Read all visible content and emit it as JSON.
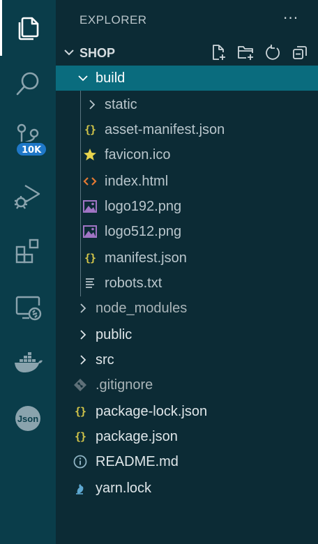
{
  "activity_bar": {
    "items": [
      {
        "name": "explorer",
        "icon": "files-icon",
        "active": true
      },
      {
        "name": "search",
        "icon": "search-icon"
      },
      {
        "name": "source-control",
        "icon": "source-control-icon",
        "badge": "10K"
      },
      {
        "name": "run-debug",
        "icon": "run-debug-icon"
      },
      {
        "name": "extensions",
        "icon": "extensions-icon"
      },
      {
        "name": "remote-explorer",
        "icon": "remote-explorer-icon"
      },
      {
        "name": "docker",
        "icon": "docker-icon"
      },
      {
        "name": "json",
        "icon": "json-icon",
        "text": "Json"
      }
    ]
  },
  "sidebar": {
    "header": "EXPLORER",
    "more": "···",
    "section": {
      "title": "SHOP",
      "actions": [
        "new-file-icon",
        "new-folder-icon",
        "refresh-icon",
        "collapse-all-icon"
      ]
    },
    "tree": [
      {
        "label": "build",
        "type": "folder",
        "expanded": true,
        "selected": true
      },
      {
        "label": "static",
        "type": "folder"
      },
      {
        "label": "asset-manifest.json",
        "type": "json"
      },
      {
        "label": "favicon.ico",
        "type": "favicon"
      },
      {
        "label": "index.html",
        "type": "html"
      },
      {
        "label": "logo192.png",
        "type": "image"
      },
      {
        "label": "logo512.png",
        "type": "image"
      },
      {
        "label": "manifest.json",
        "type": "json"
      },
      {
        "label": "robots.txt",
        "type": "text"
      },
      {
        "label": "node_modules",
        "type": "folder"
      },
      {
        "label": "public",
        "type": "folder"
      },
      {
        "label": "src",
        "type": "folder"
      },
      {
        "label": ".gitignore",
        "type": "git"
      },
      {
        "label": "package-lock.json",
        "type": "json"
      },
      {
        "label": "package.json",
        "type": "json"
      },
      {
        "label": "README.md",
        "type": "info"
      },
      {
        "label": "yarn.lock",
        "type": "yarn"
      }
    ]
  },
  "colors": {
    "activity_bar": "#0a3d4a",
    "sidebar": "#0c2b35",
    "selection": "#0a6c7e",
    "badge": "#1f78c8",
    "json_icon": "#d4c64a",
    "html_icon": "#e37933",
    "image_icon": "#a074c4",
    "favicon": "#e8d44d"
  }
}
